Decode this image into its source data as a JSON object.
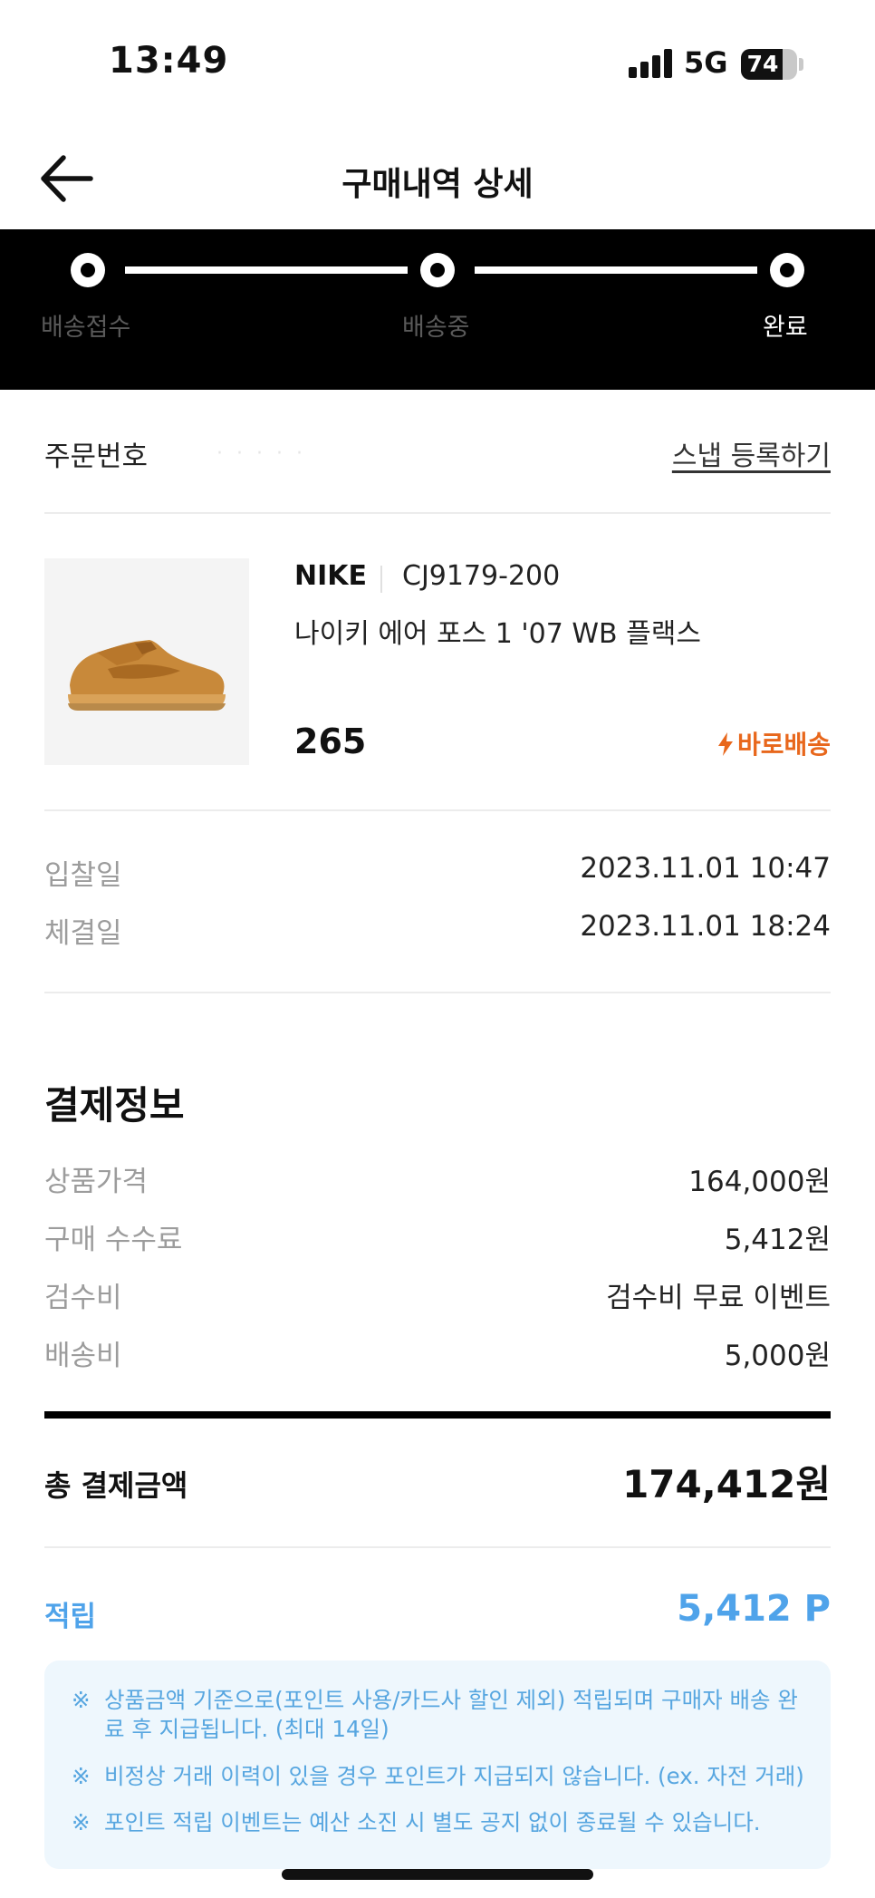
{
  "status_bar": {
    "time": "13:49",
    "network": "5G",
    "battery": "74",
    "battery_level": 0.74
  },
  "header": {
    "title": "구매내역 상세",
    "back_icon": "arrow-left-icon"
  },
  "progress": {
    "steps": [
      {
        "label": "배송접수",
        "active": false
      },
      {
        "label": "배송중",
        "active": false
      },
      {
        "label": "완료",
        "active": true
      }
    ]
  },
  "order": {
    "label": "주문번호",
    "number": "· ·  ·  ·  ·",
    "snap_link": "스냅 등록하기"
  },
  "product": {
    "brand": "NIKE",
    "code": "CJ9179-200",
    "name": "나이키 에어 포스 1 '07 WB 플랙스",
    "size": "265",
    "shipping_badge": "바로배송",
    "shipping_icon": "lightning-icon"
  },
  "dates": [
    {
      "label": "입찰일",
      "value": "2023.11.01 10:47"
    },
    {
      "label": "체결일",
      "value": "2023.11.01 18:24"
    }
  ],
  "payment": {
    "title": "결제정보",
    "rows": [
      {
        "label": "상품가격",
        "value": "164,000원"
      },
      {
        "label": "구매 수수료",
        "value": "5,412원"
      },
      {
        "label": "검수비",
        "value": "검수비 무료 이벤트"
      },
      {
        "label": "배송비",
        "value": "5,000원"
      }
    ],
    "total_label": "총 결제금액",
    "total_value": "174,412원"
  },
  "points": {
    "label": "적립",
    "value": "5,412 P",
    "notices": [
      "상품금액 기준으로(포인트 사용/카드사 할인 제외) 적립되며 구매자 배송 완료 후 지급됩니다. (최대 14일)",
      "비정상 거래 이력이 있을 경우 포인트가 지급되지 않습니다. (ex. 자전 거래)",
      "포인트 적립 이벤트는 예산 소진 시 별도 공지 없이 종료될 수 있습니다."
    ],
    "notice_mark": "※"
  },
  "colors": {
    "accent_blue": "#4fa3ea",
    "fast_ship_orange": "#e8671c",
    "progress_bg": "#000000"
  }
}
